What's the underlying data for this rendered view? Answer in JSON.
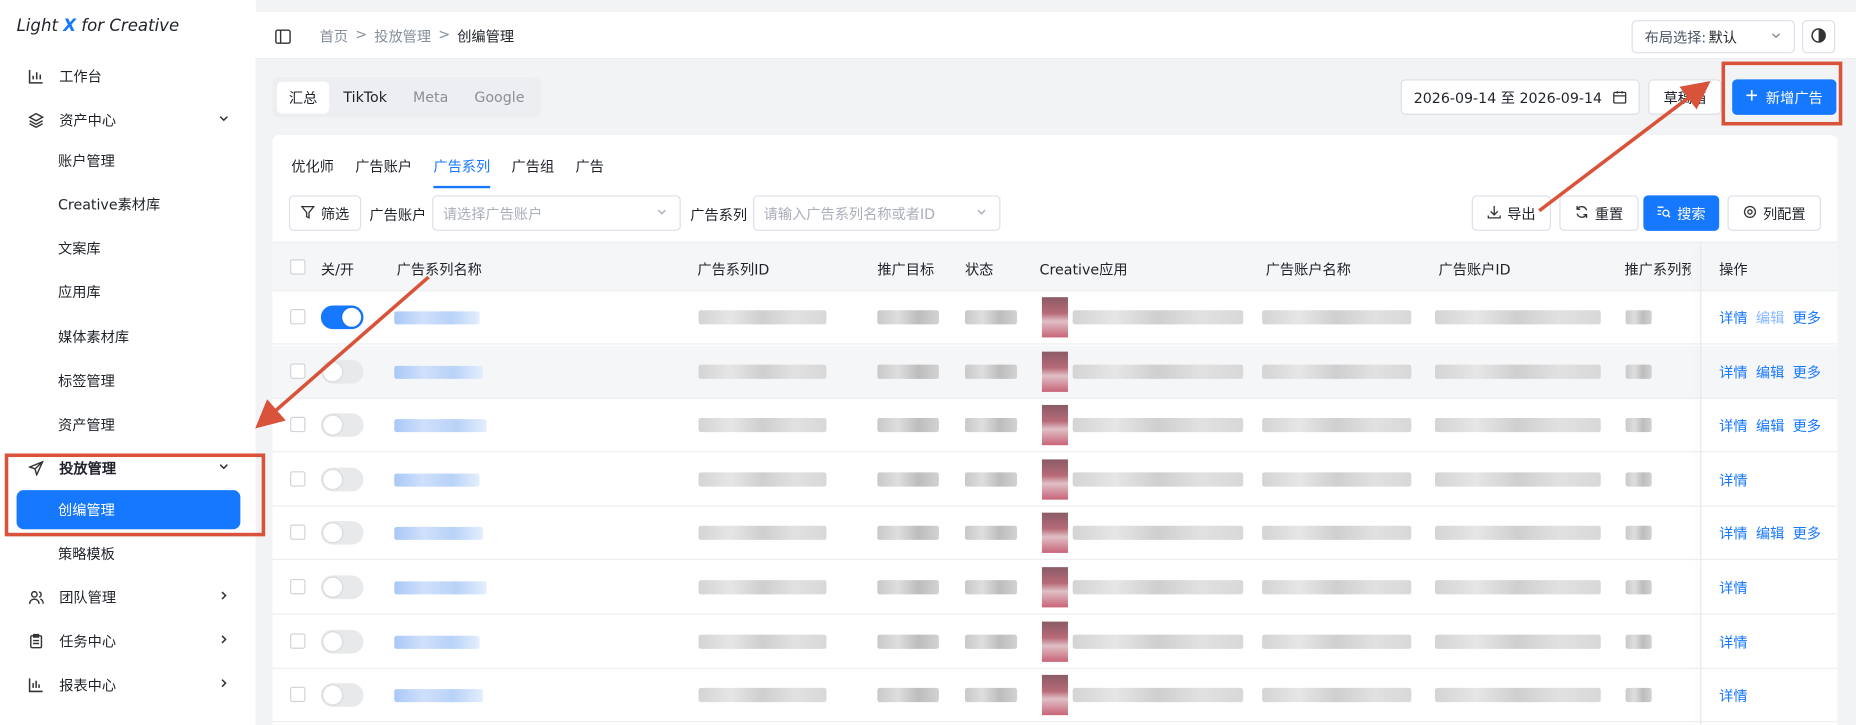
{
  "app": {
    "logo_a": "Light ",
    "logo_x": "X",
    "logo_b": " for Creative"
  },
  "sidebar": {
    "workbench": "工作台",
    "asset_center": "资产中心",
    "asset_subs": [
      "账户管理",
      "Creative素材库",
      "文案库",
      "应用库",
      "媒体素材库",
      "标签管理",
      "资产管理"
    ],
    "delivery": "投放管理",
    "creative_mgmt": "创编管理",
    "strategy": "策略模板",
    "team": "团队管理",
    "tasks": "任务中心",
    "reports": "报表中心"
  },
  "topbar": {
    "crumb1": "首页",
    "sep": ">",
    "crumb2": "投放管理",
    "crumb3": "创编管理",
    "layout_label": "布局选择:",
    "layout_value": "默认"
  },
  "platforms": [
    "汇总",
    "TikTok",
    "Meta",
    "Google"
  ],
  "date_range": "2026-09-14 至 2026-09-14",
  "draft_label": "草稿箱",
  "new_ad_label": "新增广告",
  "level_tabs": [
    "优化师",
    "广告账户",
    "广告系列",
    "广告组",
    "广告"
  ],
  "filters": {
    "filter_btn": "筛选",
    "account_label": "广告账户",
    "account_ph": "请选择广告账户",
    "series_label": "广告系列",
    "series_ph": "请输入广告系列名称或者ID",
    "export": "导出",
    "reset": "重置",
    "search": "搜索",
    "columns": "列配置"
  },
  "columns": [
    "关/开",
    "广告系列名称",
    "广告系列ID",
    "推广目标",
    "状态",
    "Creative应用",
    "广告账户名称",
    "广告账户ID",
    "推广系列预算",
    "操作"
  ],
  "ops": {
    "detail": "详情",
    "edit": "编辑",
    "more": "更多"
  },
  "rows": [
    {
      "on": true,
      "ops": [
        "详情",
        "编辑",
        "更多"
      ]
    },
    {
      "on": false,
      "ops": [
        "详情",
        "编辑",
        "更多"
      ]
    },
    {
      "on": false,
      "ops": [
        "详情",
        "编辑",
        "更多"
      ]
    },
    {
      "on": false,
      "ops": [
        "详情"
      ]
    },
    {
      "on": false,
      "ops": [
        "详情",
        "编辑",
        "更多"
      ]
    },
    {
      "on": false,
      "ops": [
        "详情"
      ]
    },
    {
      "on": false,
      "ops": [
        "详情"
      ]
    },
    {
      "on": false,
      "ops": [
        "详情"
      ]
    }
  ]
}
